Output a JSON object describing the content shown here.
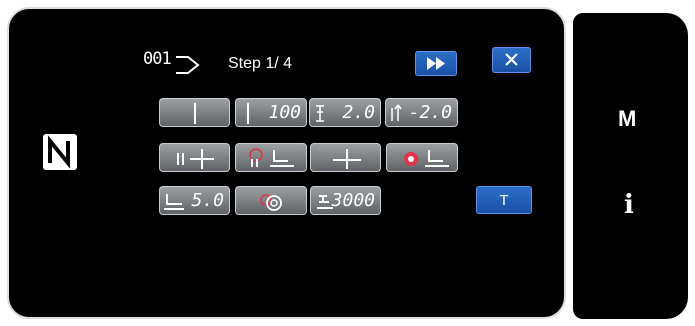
{
  "header": {
    "step_number": "001",
    "step_text": "Step  1/ 4"
  },
  "buttons": {
    "needle_count": "100",
    "pitch_value": "2.0",
    "reverse_pitch_value": "-2.0",
    "presser_height": "5.0",
    "speed_value": "3000",
    "t_label": "T"
  },
  "side": {
    "m_label": "M",
    "info_label": "i"
  },
  "icons": [
    "nfc-icon",
    "step-arrow-icon",
    "fast-forward-icon",
    "close-icon",
    "needle-icon",
    "stitch-pitch-icon",
    "thread-trim-icon",
    "presser-foot-icon",
    "tension-icon",
    "speed-icon"
  ],
  "colors": {
    "accent_blue": "#1f5bb8",
    "highlight_red": "#e0334c"
  }
}
